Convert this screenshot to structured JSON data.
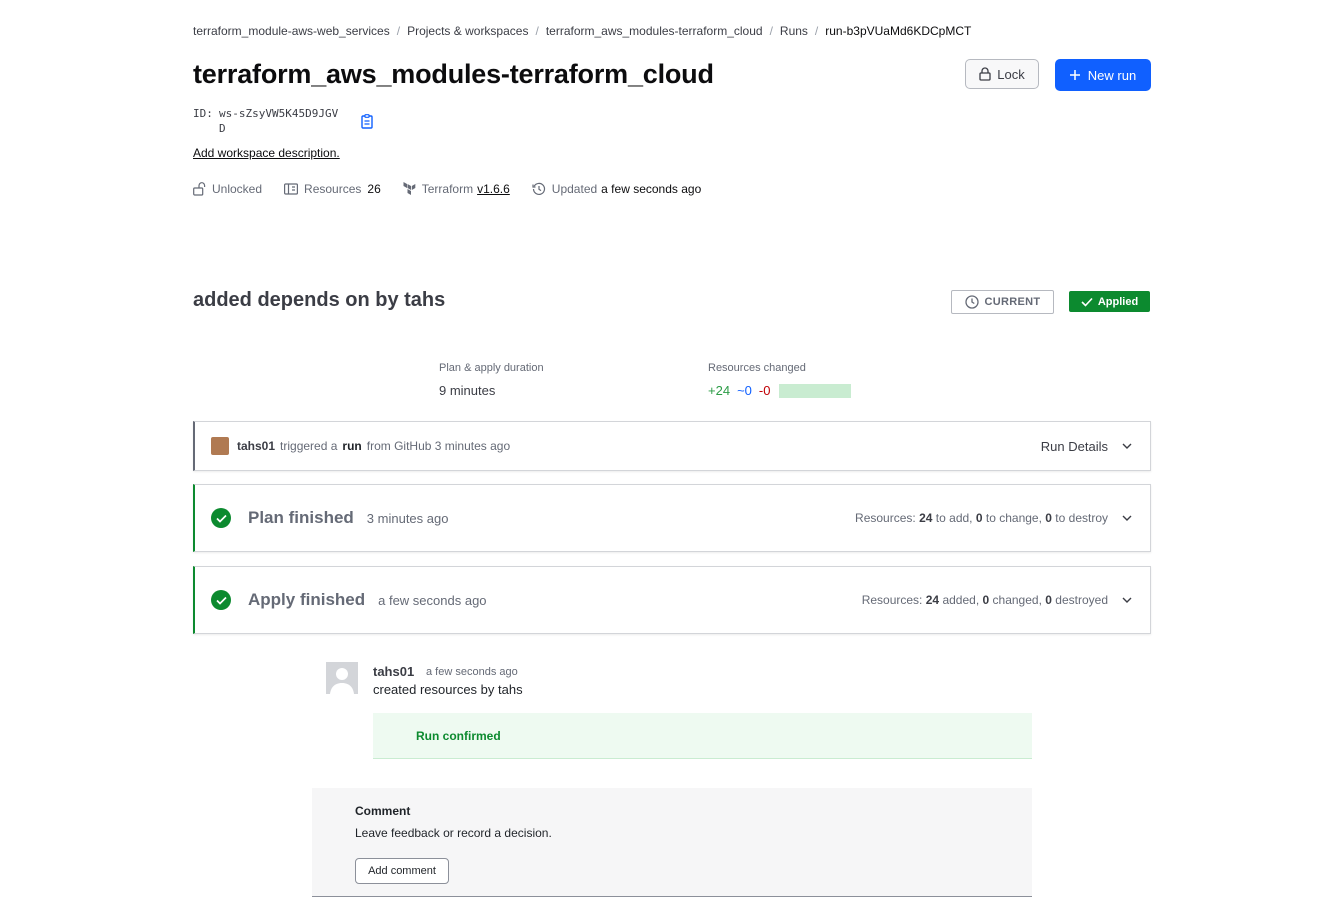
{
  "breadcrumb": {
    "items": [
      "terraform_module-aws-web_services",
      "Projects & workspaces",
      "terraform_aws_modules-terraform_cloud",
      "Runs",
      "run-b3pVUaMd6KDCpMCT"
    ]
  },
  "workspace": {
    "title": "terraform_aws_modules-terraform_cloud",
    "id_label": "ID:",
    "id_value": "ws-sZsyVW5K45D9JGVD",
    "add_description": "Add workspace description.",
    "lock_status": "Unlocked",
    "resources_label": "Resources",
    "resources_count": "26",
    "terraform_label": "Terraform",
    "terraform_version": "v1.6.6",
    "updated_label": "Updated",
    "updated_value": "a few seconds ago"
  },
  "header_actions": {
    "lock_label": "Lock",
    "new_run_label": "New run"
  },
  "run": {
    "title": "added depends on by tahs",
    "current_badge": "CURRENT",
    "status_badge": "Applied",
    "duration_label": "Plan & apply duration",
    "duration_value": "9 minutes",
    "resources_changed_label": "Resources changed",
    "added": "+24",
    "changed": "~0",
    "destroyed": "-0",
    "status_colors": {
      "applied": "#0c8a2f",
      "add": "#2c9c46",
      "change": "#1060ff",
      "destroy": "#c00005"
    }
  },
  "trigger": {
    "user": "tahs01",
    "text1": "triggered a",
    "run_word": "run",
    "text2": "from GitHub 3 minutes ago",
    "details_label": "Run Details"
  },
  "plan": {
    "title": "Plan finished",
    "time": "3 minutes ago",
    "resources_prefix": "Resources:",
    "add_count": "24",
    "add_text": "to add,",
    "change_count": "0",
    "change_text": "to change,",
    "destroy_count": "0",
    "destroy_text": "to destroy"
  },
  "apply": {
    "title": "Apply finished",
    "time": "a few seconds ago",
    "resources_prefix": "Resources:",
    "add_count": "24",
    "add_text": "added,",
    "change_count": "0",
    "change_text": "changed,",
    "destroy_count": "0",
    "destroy_text": "destroyed"
  },
  "timeline": {
    "user": "tahs01",
    "time": "a few seconds ago",
    "message": "created resources by tahs",
    "confirmed": "Run confirmed"
  },
  "comment": {
    "heading": "Comment",
    "text": "Leave feedback or record a decision.",
    "button": "Add comment"
  }
}
